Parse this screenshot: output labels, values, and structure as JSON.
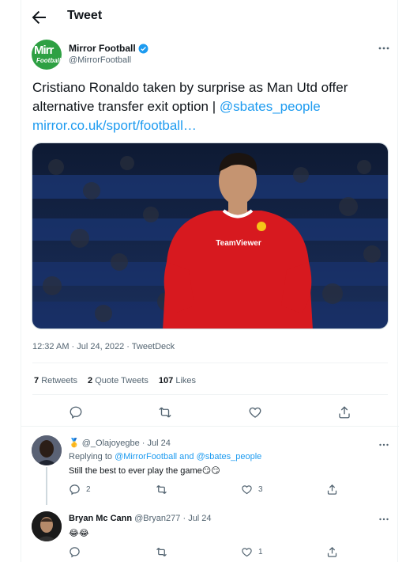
{
  "header": {
    "title": "Tweet",
    "back_icon": "arrow-left-icon"
  },
  "tweet": {
    "author_name": "Mirror Football",
    "author_handle": "@MirrorFootball",
    "avatar_text_top": "Mirr",
    "avatar_text_bottom": "Football",
    "text_plain": "Cristiano Ronaldo taken by surprise as Man Utd offer alternative transfer exit option | ",
    "text_mention": "@sbates_people",
    "text_link": "mirror.co.uk/sport/football…",
    "media_label": "TeamViewer",
    "timestamp": "12:32 AM · Jul 24, 2022 · TweetDeck",
    "retweets_count": "7",
    "retweets_label": "Retweets",
    "quotes_count": "2",
    "quotes_label": "Quote Tweets",
    "likes_count": "107",
    "likes_label": "Likes"
  },
  "replies": [
    {
      "badge": "🥇",
      "handle": "@_Olajoyegbe",
      "date": "· Jul 24",
      "replying_prefix": "Replying to ",
      "replying_to": "@MirrorFootball and @sbates_people",
      "text": "Still the best to ever play the game😏😏",
      "reply_count": "2",
      "like_count": "3"
    },
    {
      "name": "Bryan Mc Cann",
      "handle": "@Bryan277",
      "date": "· Jul 24",
      "text": "😂😂",
      "like_count": "1"
    }
  ],
  "colors": {
    "accent": "#1d9bf0",
    "muted": "#536471",
    "mirror_green": "#2ea043",
    "kit_red": "#d7191f"
  }
}
